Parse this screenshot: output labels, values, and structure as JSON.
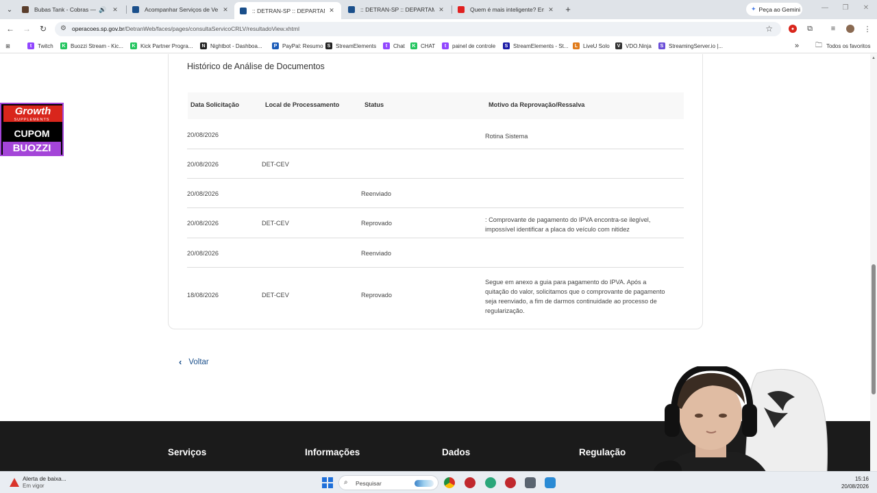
{
  "browser": {
    "tabs": [
      {
        "title": "Bubas Tank - Cobras — Baixo",
        "favicon_color": "#5a3d2b"
      },
      {
        "title": "Acompanhar Serviços de Veícu",
        "favicon_color": "#1a4f8b"
      },
      {
        "title": ":: DETRAN-SP :: DEPARTAMENT",
        "favicon_color": "#1a4f8b"
      },
      {
        "title": ":: DETRAN-SP :: DEPARTAMENT",
        "favicon_color": "#1a4f8b"
      },
      {
        "title": "Quem é mais inteligente? Enge",
        "favicon_color": "#e02020"
      }
    ],
    "new_tab": "+",
    "gemini_label": "Peça ao Gemini",
    "url_host": "operacoes.sp.gov.br",
    "url_path": "/DetranWeb/faces/pages/consultaServicoCRLV/resultadoView.xhtml",
    "bookmarks": [
      {
        "label": "Twitch",
        "color": "#9146ff",
        "glyph": "t"
      },
      {
        "label": "Buozzi Stream - Kic...",
        "color": "#22c55e",
        "glyph": "K"
      },
      {
        "label": "Kick Partner Progra...",
        "color": "#22c55e",
        "glyph": "K"
      },
      {
        "label": "Nightbot - Dashboa...",
        "color": "#222222",
        "glyph": "N"
      },
      {
        "label": "PayPal: Resumo",
        "color": "#1a5bb8",
        "glyph": "P"
      },
      {
        "label": "StreamElements",
        "color": "#222222",
        "glyph": "S"
      },
      {
        "label": "Chat",
        "color": "#9146ff",
        "glyph": "t"
      },
      {
        "label": "CHAT",
        "color": "#22c55e",
        "glyph": "K"
      },
      {
        "label": "painel de controle",
        "color": "#9146ff",
        "glyph": "t"
      },
      {
        "label": "StreamElements - St...",
        "color": "#1a1aa6",
        "glyph": "S"
      },
      {
        "label": "LiveU Solo",
        "color": "#e07b1a",
        "glyph": "L"
      },
      {
        "label": "VDO.Ninja",
        "color": "#333333",
        "glyph": "V"
      },
      {
        "label": "StreamingServer.io |...",
        "color": "#6b4fd8",
        "glyph": "S"
      }
    ],
    "bookmarks_more": "»",
    "all_favorites": "Todos os favoritos"
  },
  "page": {
    "section_title": "Histórico de Análise de Documentos",
    "columns": [
      "Data Solicitação",
      "Local de Processamento",
      "Status",
      "Motivo da Reprovação/Ressalva"
    ],
    "rows": [
      {
        "data": "20/08/2026",
        "local": "",
        "status": "",
        "motivo": "Rotina Sistema"
      },
      {
        "data": "20/08/2026",
        "local": "DET-CEV",
        "status": "",
        "motivo": ""
      },
      {
        "data": "20/08/2026",
        "local": "",
        "status": "Reenviado",
        "motivo": ""
      },
      {
        "data": "20/08/2026",
        "local": "DET-CEV",
        "status": "Reprovado",
        "motivo": ": Comprovante de pagamento do IPVA encontra-se ilegível, impossível identificar a placa do veículo com nitidez"
      },
      {
        "data": "20/08/2026",
        "local": "",
        "status": "Reenviado",
        "motivo": ""
      },
      {
        "data": "18/08/2026",
        "local": "DET-CEV",
        "status": "Reprovado",
        "motivo": "Segue em anexo a guia para pagamento do IPVA. Após a quitação do valor, solicitamos que o comprovante de pagamento seja reenviado, a fim de darmos continuidade ao processo de regularização."
      }
    ],
    "back_label": "Voltar",
    "footer_headings": [
      "Serviços",
      "Informações",
      "Dados",
      "Regulação"
    ]
  },
  "overlay": {
    "promo_brand": "Growth",
    "promo_sub": "SUPPLEMENTS",
    "promo_cupom": "CUPOM",
    "promo_code": "BUOZZI"
  },
  "taskbar": {
    "alert_title": "Alerta de baixa...",
    "alert_sub": "Em vigor",
    "search_placeholder": "Pesquisar",
    "time": "15:16",
    "date": "20/08/2026"
  }
}
